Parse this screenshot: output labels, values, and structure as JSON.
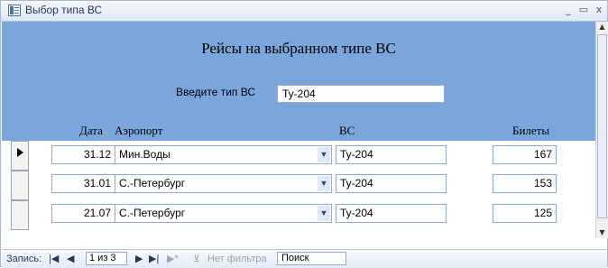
{
  "window": {
    "title": "Выбор типа ВС"
  },
  "header": {
    "form_title": "Рейсы на выбранном типе ВС",
    "type_label": "Введите тип ВС",
    "type_value": "Ту-204"
  },
  "columns": {
    "date": "Дата",
    "airport": "Аэропорт",
    "aircraft": "ВС",
    "tickets": "Билеты"
  },
  "rows": [
    {
      "date": "31.12",
      "airport": "Мин.Воды",
      "aircraft": "Ту-204",
      "tickets": "167"
    },
    {
      "date": "31.01",
      "airport": "С.-Петербург",
      "aircraft": "Ту-204",
      "tickets": "153"
    },
    {
      "date": "21.07",
      "airport": "С.-Петербург",
      "aircraft": "Ту-204",
      "tickets": "125"
    }
  ],
  "navigation": {
    "record_label": "Запись:",
    "record_value": "1 из 3",
    "filter_label": "Нет фильтра",
    "search_label": "Поиск"
  }
}
